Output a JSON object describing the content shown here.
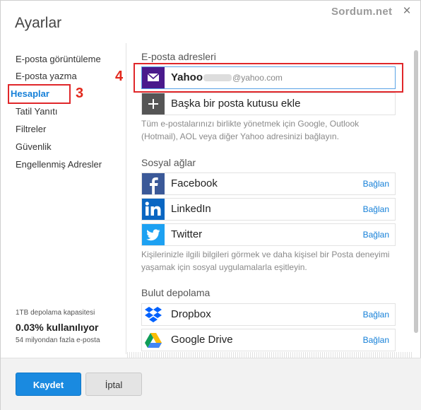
{
  "window": {
    "title": "Ayarlar",
    "brand": "Sordum.net",
    "close_icon": "×"
  },
  "sidebar": {
    "items": [
      {
        "label": "E-posta görüntüleme"
      },
      {
        "label": "E-posta yazma"
      },
      {
        "label": "Hesaplar"
      },
      {
        "label": "Tatil Yanıtı"
      },
      {
        "label": "Filtreler"
      },
      {
        "label": "Güvenlik"
      },
      {
        "label": "Engellenmiş Adresler"
      }
    ],
    "storage": {
      "capacity": "1TB depolama kapasitesi",
      "usage": "0.03% kullanılıyor",
      "emails": "54 milyondan fazla e-posta"
    }
  },
  "annotations": {
    "hesaplar": "3",
    "yahoo": "4"
  },
  "email_section": {
    "title": "E-posta adresleri",
    "yahoo": {
      "name": "Yahoo",
      "domain": "@yahoo.com"
    },
    "add": {
      "label": "Başka bir posta kutusu ekle"
    },
    "description": "Tüm e-postalarınızı birlikte yönetmek için Google, Outlook (Hotmail), AOL veya diğer Yahoo adresinizi bağlayın."
  },
  "social_section": {
    "title": "Sosyal ağlar",
    "items": [
      {
        "name": "Facebook",
        "action": "Bağlan"
      },
      {
        "name": "LinkedIn",
        "action": "Bağlan"
      },
      {
        "name": "Twitter",
        "action": "Bağlan"
      }
    ],
    "description": "Kişilerinizle ilgili bilgileri görmek ve daha kişisel bir Posta deneyimi yaşamak için sosyal uygulamalarla eşitleyin."
  },
  "cloud_section": {
    "title": "Bulut depolama",
    "items": [
      {
        "name": "Dropbox",
        "action": "Bağlan"
      },
      {
        "name": "Google Drive",
        "action": "Bağlan"
      }
    ]
  },
  "footer": {
    "save": "Kaydet",
    "cancel": "İptal"
  },
  "colors": {
    "accent": "#1680d8",
    "annotation": "#e0272a",
    "yahoo": "#4a1a8c",
    "facebook": "#3b5998",
    "linkedin": "#0a66c2",
    "twitter": "#1da1f2",
    "dropbox": "#0061fe"
  }
}
